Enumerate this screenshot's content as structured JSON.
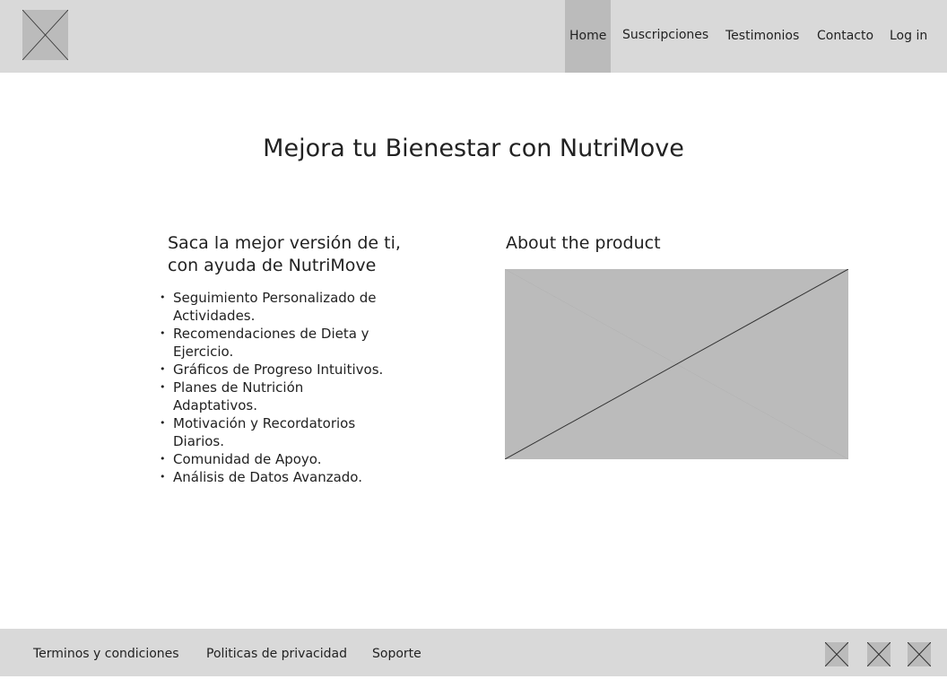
{
  "header": {
    "logo": "logo-placeholder",
    "nav": [
      "Home",
      "Suscripciones",
      "Testimonios",
      "Contacto",
      "Log in"
    ],
    "active": "Home"
  },
  "main": {
    "title": "Mejora tu Bienestar con NutriMove",
    "left": {
      "heading": "Saca la mejor versión de ti, con ayuda de NutriMove",
      "features": [
        "Seguimiento Personalizado de Actividades.",
        "Recomendaciones de Dieta y Ejercicio.",
        "Gráficos de Progreso Intuitivos.",
        "Planes de Nutrición Adaptativos.",
        "Motivación y Recordatorios Diarios.",
        "Comunidad de Apoyo.",
        "Análisis de Datos Avanzado."
      ]
    },
    "right": {
      "heading": "About the product"
    }
  },
  "footer": {
    "links": [
      "Terminos y condiciones",
      "Politicas de privacidad",
      "Soporte"
    ],
    "social_icons": [
      "social-icon-1",
      "social-icon-2",
      "social-icon-3"
    ]
  }
}
